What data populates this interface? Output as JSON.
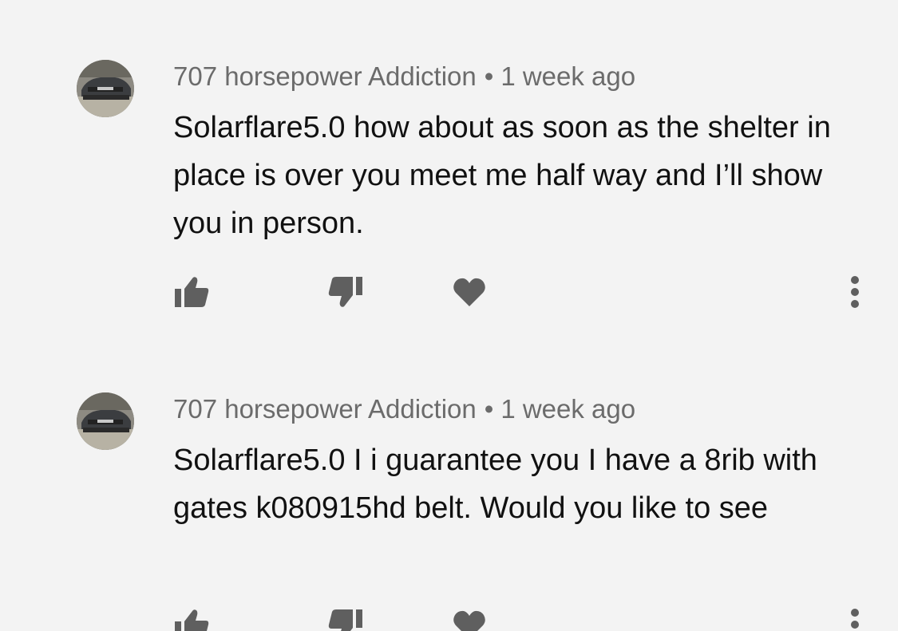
{
  "colors": {
    "background": "#f3f3f3",
    "meta_text": "#6b6b6b",
    "body_text": "#111111",
    "icon": "#5f5f5f"
  },
  "comments": [
    {
      "author": "707 horsepower Addiction",
      "separator": "•",
      "time": "1 week ago",
      "text": "Solarflare5.0 how about as soon as the shelter in place is over you meet me half way and I’ll show you in person.",
      "avatar_icon": "car-avatar",
      "actions": [
        "thumb-up-icon",
        "thumb-down-icon",
        "heart-icon",
        "more-vertical-icon"
      ]
    },
    {
      "author": "707 horsepower Addiction",
      "separator": "•",
      "time": "1 week ago",
      "text": "Solarflare5.0 I i guarantee you I have a 8rib with gates k080915hd belt. Would you like to see",
      "avatar_icon": "car-avatar",
      "actions": [
        "thumb-up-icon",
        "thumb-down-icon",
        "heart-icon",
        "more-vertical-icon"
      ]
    }
  ]
}
